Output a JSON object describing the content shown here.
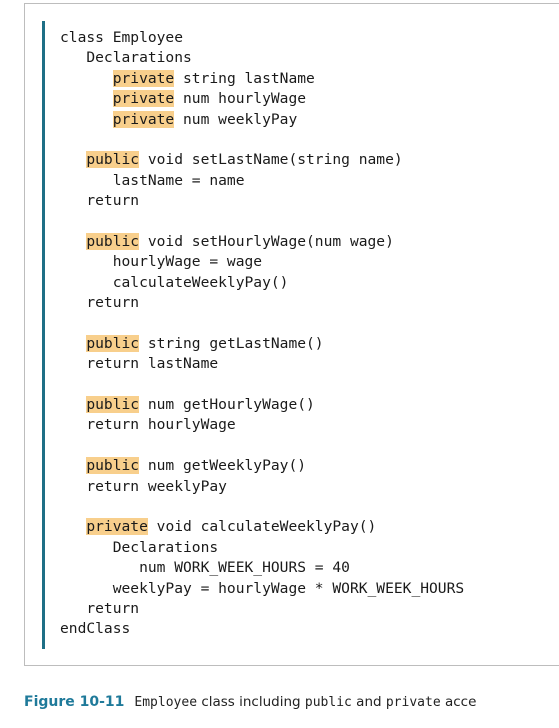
{
  "code": {
    "line1": "class Employee",
    "line2": "   Declarations",
    "line3_kw": "private",
    "line3_rest": " string lastName",
    "line4_kw": "private",
    "line4_rest": " num hourlyWage",
    "line5_kw": "private",
    "line5_rest": " num weeklyPay",
    "line7_kw": "public",
    "line7_rest": " void setLastName(string name)",
    "line8": "      lastName = name",
    "line9": "   return",
    "line11_kw": "public",
    "line11_rest": " void setHourlyWage(num wage)",
    "line12": "      hourlyWage = wage",
    "line13": "      calculateWeeklyPay()",
    "line14": "   return",
    "line16_kw": "public",
    "line16_rest": " string getLastName()",
    "line17": "   return lastName",
    "line19_kw": "public",
    "line19_rest": " num getHourlyWage()",
    "line20": "   return hourlyWage",
    "line22_kw": "public",
    "line22_rest": " num getWeeklyPay()",
    "line23": "   return weeklyPay",
    "line25_kw": "private",
    "line25_rest": " void calculateWeeklyPay()",
    "line26": "      Declarations",
    "line27": "         num WORK_WEEK_HOURS = 40",
    "line28": "      weeklyPay = hourlyWage * WORK_WEEK_HOURS",
    "line29": "   return",
    "line30": "endClass"
  },
  "caption": {
    "figure_label": "Figure 10-11",
    "class_name": "Employee",
    "text1": " class including ",
    "kw_public": "public",
    "text2": " and ",
    "kw_private": "private",
    "text3": " acce"
  },
  "colors": {
    "keyword_highlight": "#f8cf8c",
    "left_bar": "#1e6f86",
    "figure_label": "#1f7a9a"
  }
}
